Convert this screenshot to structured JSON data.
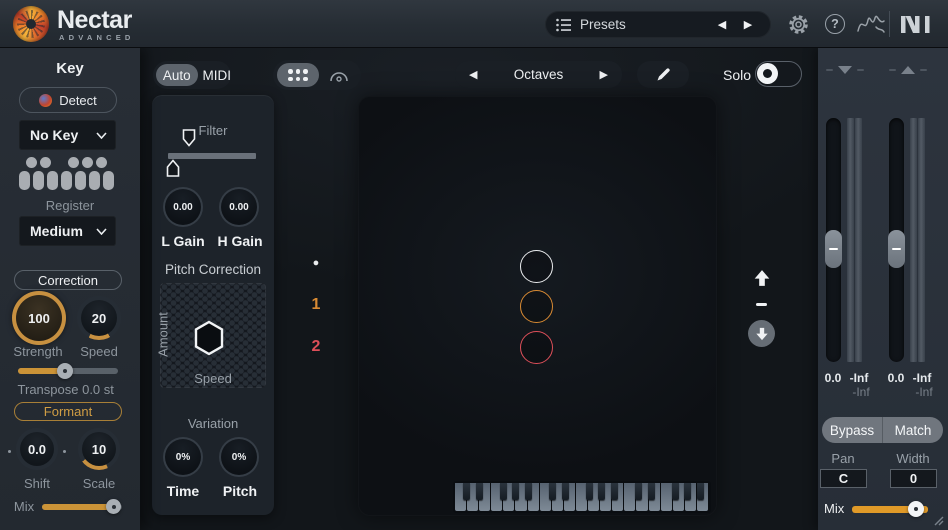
{
  "colors": {
    "accent_orange": "#cb9337",
    "voice_white": "#e9ebed",
    "voice_orange": "#d88a33",
    "voice_red": "#dd4f59"
  },
  "icons": {
    "presets_menu": "list",
    "prev_glyph": "◀",
    "next_glyph": "▶",
    "settings": "gear",
    "help_glyph": "?",
    "signature": "scribble",
    "ni_logo": "NI",
    "grid": "dots-grid",
    "arc": "arc",
    "pencil": "pencil",
    "octave_up": "arrow-up",
    "octave_down": "arrow-down"
  },
  "topbar": {
    "brand": "Nectar",
    "brand_sub": "ADVANCED",
    "presets_label": "Presets",
    "prev_glyph": "◀",
    "next_glyph": "▶",
    "help_glyph": "?"
  },
  "sidebar": {
    "title": "Key",
    "detect_label": "Detect",
    "key_select": "No Key",
    "register_label": "Register",
    "register_select": "Medium",
    "correction_label": "Correction",
    "strength": {
      "value": "100",
      "label": "Strength"
    },
    "speed": {
      "value": "20",
      "label": "Speed"
    },
    "transpose": {
      "label": "Transpose",
      "value": "0.0 st"
    },
    "formant_label": "Formant",
    "shift": {
      "value": "0.0",
      "label": "Shift"
    },
    "scale": {
      "value": "10",
      "label": "Scale"
    },
    "mix_label": "Mix"
  },
  "toolbar": {
    "auto_label": "Auto",
    "midi_label": "MIDI",
    "view_label": "Octaves",
    "prev_glyph": "◀",
    "next_glyph": "▶",
    "solo_label": "Solo"
  },
  "tools_panel": {
    "filter_label": "Filter",
    "l_gain": {
      "value": "0.00",
      "label": "L Gain"
    },
    "h_gain": {
      "value": "0.00",
      "label": "H Gain"
    },
    "pitch_correction_label": "Pitch Correction",
    "amount_label": "Amount",
    "speed_label": "Speed",
    "variation_label": "Variation",
    "time": {
      "value": "0%",
      "label": "Time"
    },
    "pitch": {
      "value": "0%",
      "label": "Pitch"
    }
  },
  "display": {
    "voices": [
      {
        "label": "●",
        "color": "#e9ebed"
      },
      {
        "label": "1",
        "color": "#d88a33"
      },
      {
        "label": "2",
        "color": "#dd4f59"
      }
    ]
  },
  "meters": {
    "groups": [
      {
        "fader_value": "0.0",
        "meter_value": "-Inf",
        "peak_value": "-Inf"
      },
      {
        "fader_value": "0.0",
        "meter_value": "-Inf",
        "peak_value": "-Inf"
      }
    ],
    "bypass_label": "Bypass",
    "match_label": "Match",
    "pan": {
      "label": "Pan",
      "value": "C"
    },
    "width": {
      "label": "Width",
      "value": "0"
    },
    "mix_label": "Mix"
  }
}
